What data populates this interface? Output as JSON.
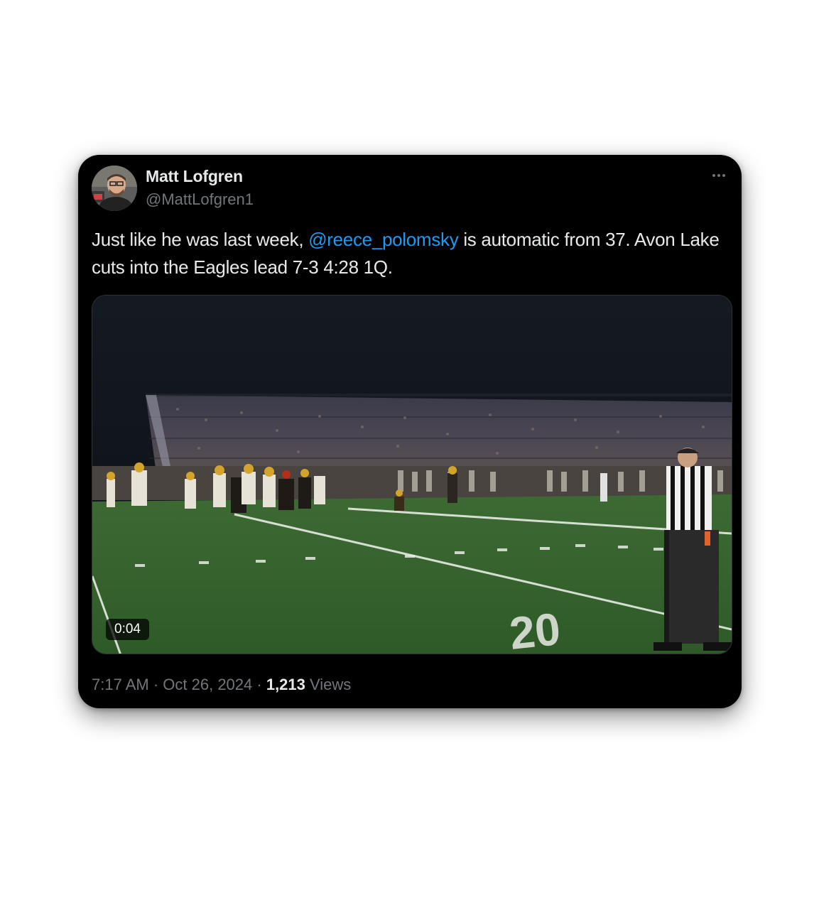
{
  "author": {
    "name": "Matt Lofgren",
    "handle": "@MattLofgren1"
  },
  "tweet": {
    "text_before": "Just like he was last week, ",
    "mention": "@reece_polomsky",
    "text_after": " is automatic from 37. Avon Lake cuts into the Eagles lead 7-3 4:28 1Q."
  },
  "media": {
    "duration": "0:04",
    "yard_marker": "20"
  },
  "meta": {
    "time": "7:17 AM",
    "separator1": " · ",
    "date": "Oct 26, 2024",
    "separator2": " · ",
    "views_count": "1,213",
    "views_label": " Views"
  },
  "icons": {
    "more": "more-horizontal-icon"
  },
  "colors": {
    "background": "#000000",
    "text_primary": "#e7e9ea",
    "text_secondary": "#71767b",
    "link": "#1d9bf0"
  }
}
